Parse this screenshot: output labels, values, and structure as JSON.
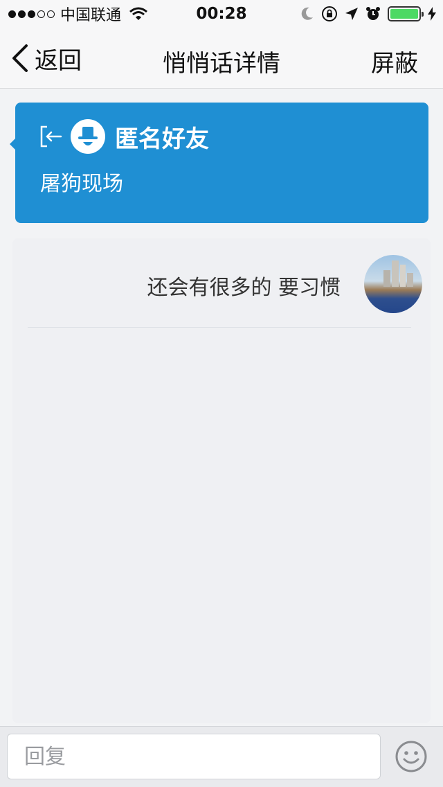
{
  "status_bar": {
    "carrier": "中国联通",
    "time": "00:28",
    "signal_dots_filled": 3,
    "signal_dots_total": 5,
    "battery_level": 1.0
  },
  "nav": {
    "back_label": "返回",
    "title": "悄悄话详情",
    "block_label": "屏蔽"
  },
  "message": {
    "sender_name": "匿名好友",
    "content": "屠狗现场"
  },
  "replies": [
    {
      "text": "还会有很多的 要习惯"
    }
  ],
  "input": {
    "placeholder": "回复"
  },
  "colors": {
    "card": "#1f8fd3",
    "background": "#f2f3f5",
    "battery": "#4cd964"
  }
}
